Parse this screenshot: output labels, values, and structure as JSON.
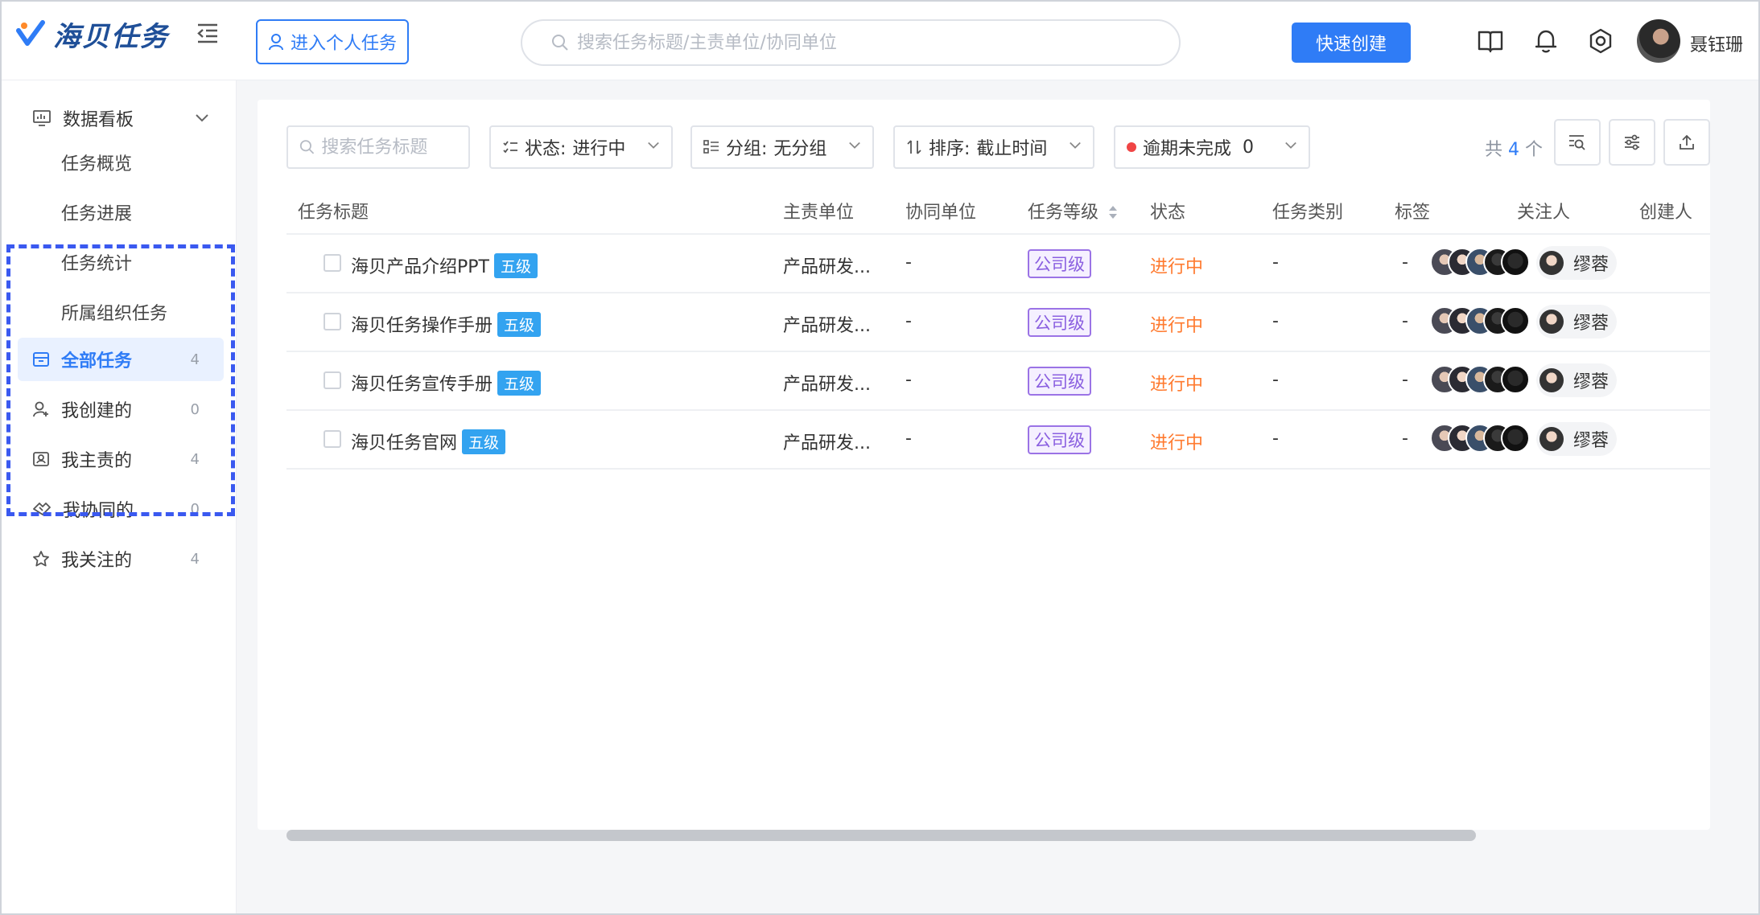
{
  "app": {
    "logo_text": "海贝任务",
    "colors": {
      "primary": "#2f7cf6",
      "accent_orange": "#ff7a2f",
      "tag_blue": "#33a3f0",
      "grade_purple": "#8a5fe0",
      "highlight_dashed": "#3a59f0"
    }
  },
  "header": {
    "personal_task_label": "进入个人任务",
    "search_placeholder": "搜索任务标题/主责单位/协同单位",
    "quick_create_label": "快速创建",
    "user_name": "聂钰珊",
    "icons": [
      "book-icon",
      "bell-icon",
      "settings-icon"
    ]
  },
  "sidebar": {
    "dashboard_label": "数据看板",
    "dashboard_sub": [
      "任务概览",
      "任务进展",
      "任务统计",
      "所属组织任务"
    ],
    "items": [
      {
        "label": "全部任务",
        "count": "4",
        "icon": "inbox-icon"
      },
      {
        "label": "我创建的",
        "count": "0",
        "icon": "user-add-icon"
      },
      {
        "label": "我主责的",
        "count": "4",
        "icon": "id-card-icon"
      },
      {
        "label": "我协同的",
        "count": "0",
        "icon": "handshake-icon"
      },
      {
        "label": "我关注的",
        "count": "4",
        "icon": "star-icon"
      }
    ]
  },
  "filters": {
    "search_placeholder": "搜索任务标题",
    "status_label": "状态:",
    "status_value": "进行中",
    "group_label": "分组:",
    "group_value": "无分组",
    "sort_label": "排序:",
    "sort_value": "截止时间",
    "overdue_label": "逾期未完成",
    "overdue_value": "0",
    "total_prefix": "共",
    "total_count": "4",
    "total_suffix": "个"
  },
  "table": {
    "columns": [
      "任务标题",
      "主责单位",
      "协同单位",
      "任务等级",
      "状态",
      "任务类别",
      "标签",
      "关注人",
      "创建人"
    ],
    "rows": [
      {
        "title": "海贝产品介绍PPT",
        "level": "五级",
        "owner_unit": "产品研发...",
        "co_unit": "-",
        "grade": "公司级",
        "status": "进行中",
        "category": "-",
        "tag": "-",
        "creator": "缪蓉"
      },
      {
        "title": "海贝任务操作手册",
        "level": "五级",
        "owner_unit": "产品研发...",
        "co_unit": "-",
        "grade": "公司级",
        "status": "进行中",
        "category": "-",
        "tag": "-",
        "creator": "缪蓉"
      },
      {
        "title": "海贝任务宣传手册",
        "level": "五级",
        "owner_unit": "产品研发...",
        "co_unit": "-",
        "grade": "公司级",
        "status": "进行中",
        "category": "-",
        "tag": "-",
        "creator": "缪蓉"
      },
      {
        "title": "海贝任务官网",
        "level": "五级",
        "owner_unit": "产品研发...",
        "co_unit": "-",
        "grade": "公司级",
        "status": "进行中",
        "category": "-",
        "tag": "-",
        "creator": "缪蓉"
      }
    ]
  }
}
